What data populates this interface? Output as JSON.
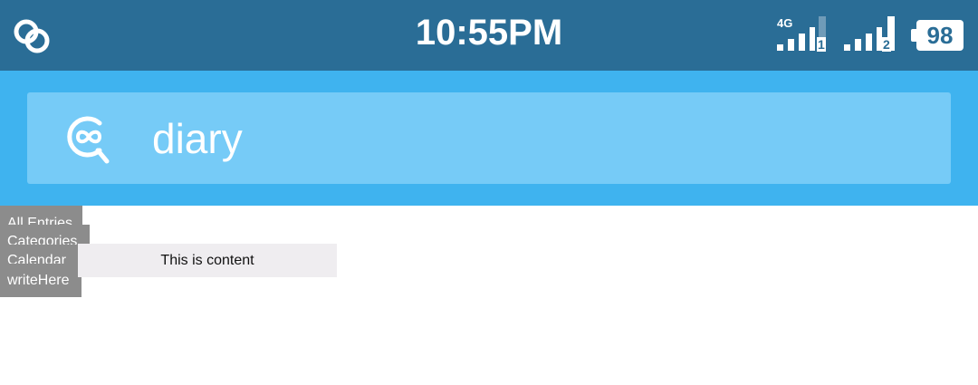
{
  "status_bar": {
    "time": "10:55PM",
    "network_type": "4G",
    "sim1_label": "1",
    "sim2_label": "2",
    "battery_level": "98",
    "app_icon": "chain-link-icon",
    "background_color": "#2a6d96"
  },
  "app_header": {
    "title": "diary",
    "logo_icon": "search-infinity-logo-icon",
    "background_color": "#3fb3ef",
    "panel_color": "#76cbf7"
  },
  "menu": {
    "items": [
      {
        "label": "All Entries"
      },
      {
        "label": "Categories"
      },
      {
        "label": "Calendar"
      },
      {
        "label": "writeHere"
      }
    ],
    "background_color": "#8c8c8c"
  },
  "content": {
    "text": "This is content"
  }
}
